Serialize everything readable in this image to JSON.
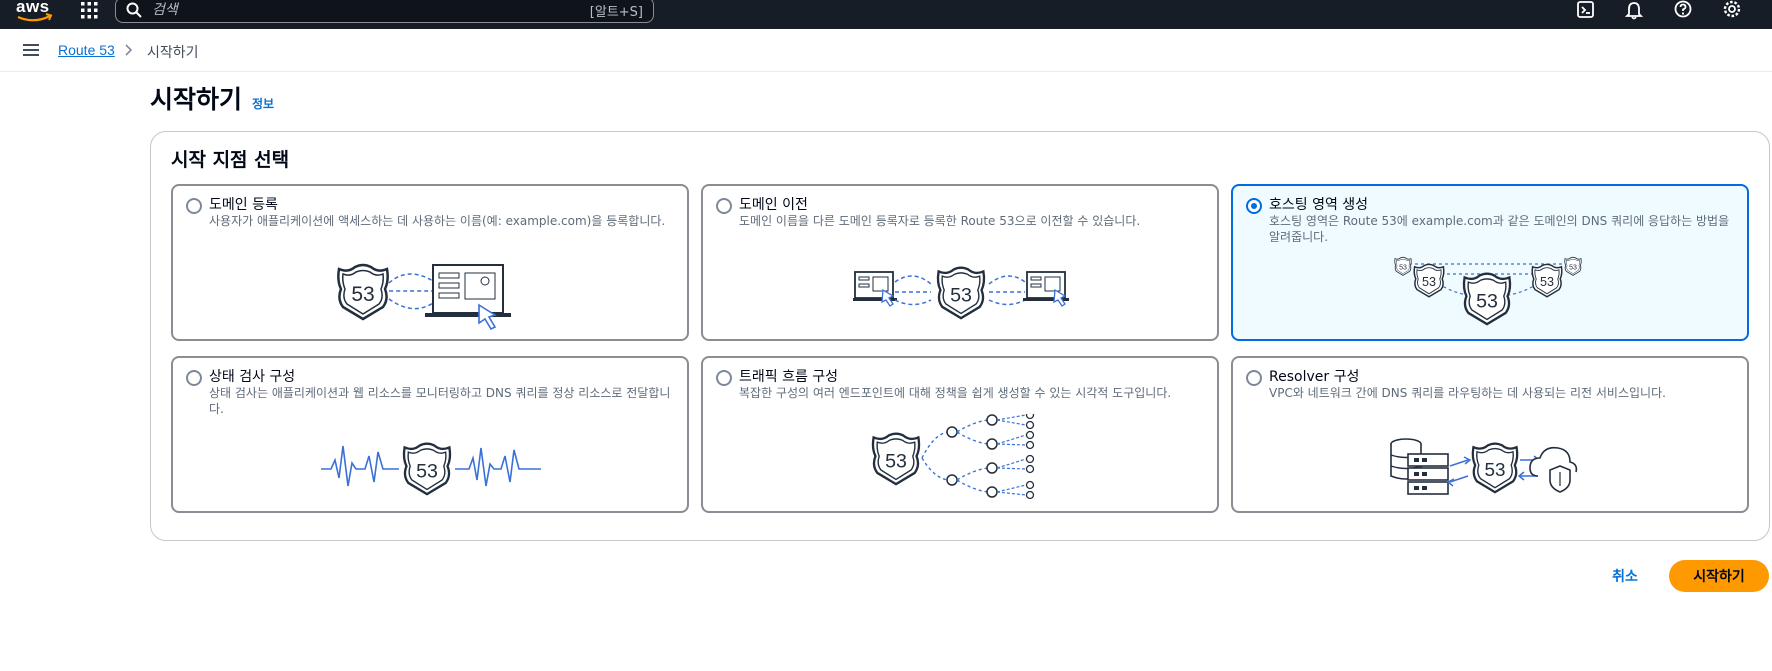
{
  "topbar": {
    "logo_text": "aws",
    "search_placeholder": "검색",
    "search_shortcut": "[알트+S]",
    "icons": [
      "services-grid-icon",
      "search-icon",
      "cloudshell-icon",
      "bell-icon",
      "help-icon",
      "settings-icon"
    ]
  },
  "breadcrumb": {
    "root": "Route 53",
    "current": "시작하기"
  },
  "page": {
    "title": "시작하기",
    "info_link": "정보"
  },
  "panel": {
    "title": "시작 지점 선택",
    "selected": "호스팅 영역 생성",
    "options": [
      {
        "title": "도메인 등록",
        "description": "사용자가 애플리케이션에 액세스하는 데 사용하는 이름(예: example.com)을 등록합니다.",
        "selected": false
      },
      {
        "title": "도메인 이전",
        "description": "도메인 이름을 다른 도메인 등록자로 등록한 Route 53으로 이전할 수 있습니다.",
        "selected": false
      },
      {
        "title": "호스팅 영역 생성",
        "description": "호스팅 영역은 Route 53에 example.com과 같은 도메인의 DNS 쿼리에 응답하는 방법을 알려줍니다.",
        "selected": true
      },
      {
        "title": "상태 검사 구성",
        "description": "상태 검사는 애플리케이션과 웹 리소스를 모니터링하고 DNS 쿼리를 정상 리소스로 전달합니다.",
        "selected": false
      },
      {
        "title": "트래픽 흐름 구성",
        "description": "복잡한 구성의 여러 엔드포인트에 대해 정책을 쉽게 생성할 수 있는 시각적 도구입니다.",
        "selected": false
      },
      {
        "title": "Resolver 구성",
        "description": "VPC와 네트워크 간에 DNS 쿼리를 라우팅하는 데 사용되는 리전 서비스입니다.",
        "selected": false
      }
    ],
    "shield_number": "53"
  },
  "footer": {
    "cancel_label": "취소",
    "start_label": "시작하기"
  },
  "colors": {
    "topbar_bg": "#161d26",
    "link": "#0972d3",
    "selected_border": "#006ce0",
    "selected_bg": "#f0fbff",
    "primary_button": "#ff9900",
    "illustration_blue": "#3a71d6"
  }
}
